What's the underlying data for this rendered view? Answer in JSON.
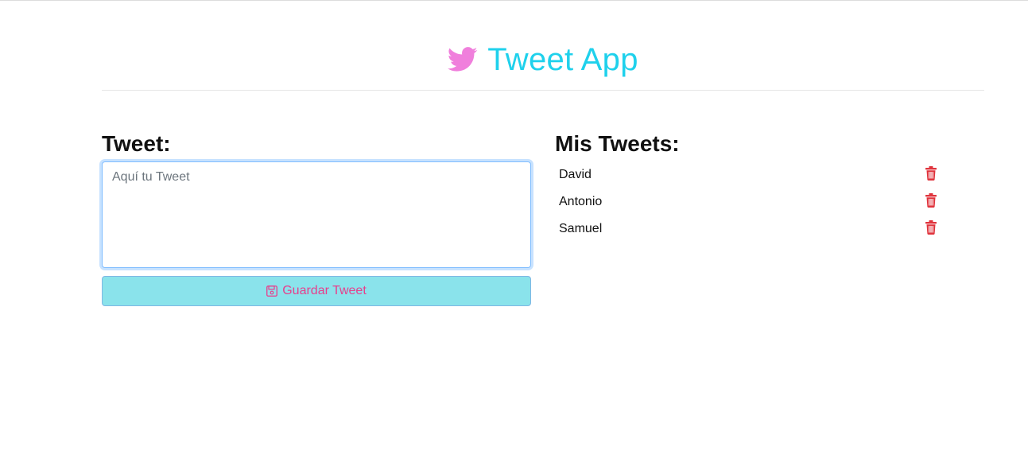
{
  "header": {
    "title": "Tweet App",
    "icon": "twitter-bird-icon",
    "title_color": "#1fd1ec",
    "icon_color": "#f07fdc"
  },
  "composer": {
    "heading": "Tweet:",
    "textarea_placeholder": "Aquí tu Tweet",
    "textarea_value": "",
    "save_button_label": "Guardar Tweet",
    "save_button_icon": "floppy-disk-icon"
  },
  "tweets": {
    "heading": "Mis Tweets:",
    "items": [
      {
        "text": "David",
        "action_icon": "trash-icon"
      },
      {
        "text": "Antonio",
        "action_icon": "trash-icon"
      },
      {
        "text": "Samuel",
        "action_icon": "trash-icon"
      }
    ],
    "delete_color": "#e0343d"
  },
  "colors": {
    "accent": "#1fd1ec",
    "button_bg": "#8ae3eb",
    "button_text": "#e83e8c"
  }
}
